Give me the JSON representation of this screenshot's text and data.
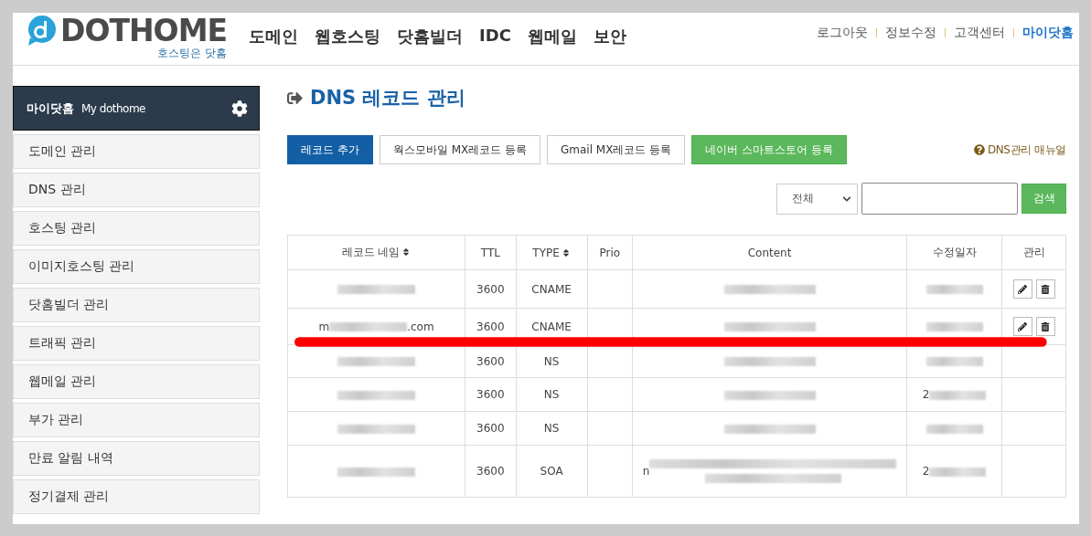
{
  "header": {
    "logo": {
      "name": "DOTHOME",
      "tagline": "호스팅은 닷홈"
    },
    "nav": [
      "도메인",
      "웹호스팅",
      "닷홈빌더",
      "IDC",
      "웹메일",
      "보안"
    ],
    "links": [
      {
        "label": "로그아웃",
        "selected": false
      },
      {
        "label": "정보수정",
        "selected": false
      },
      {
        "label": "고객센터",
        "selected": false
      },
      {
        "label": "마이닷홈",
        "selected": true
      }
    ]
  },
  "sidebar": {
    "title": "마이닷홈",
    "subtitle": "My dothome",
    "items": [
      "도메인 관리",
      "DNS 관리",
      "호스팅 관리",
      "이미지호스팅 관리",
      "닷홈빌더 관리",
      "트래픽 관리",
      "웹메일 관리",
      "부가 관리",
      "만료 알림 내역",
      "정기결제 관리"
    ]
  },
  "page": {
    "title": "DNS 레코드 관리",
    "buttons": [
      {
        "label": "레코드 추가",
        "kind": "primary"
      },
      {
        "label": "웍스모바일 MX레코드 등록",
        "kind": "plain"
      },
      {
        "label": "Gmail MX레코드 등록",
        "kind": "plain"
      },
      {
        "label": "네이버 스마트스토어 등록",
        "kind": "success"
      }
    ],
    "manual_link": "DNS관리 매뉴얼",
    "search": {
      "filter": "전체",
      "button": "검색"
    },
    "table": {
      "columns": [
        {
          "label": "레코드 네임",
          "sortable": true
        },
        {
          "label": "TTL",
          "sortable": false
        },
        {
          "label": "TYPE",
          "sortable": true
        },
        {
          "label": "Prio",
          "sortable": false
        },
        {
          "label": "Content",
          "sortable": false
        },
        {
          "label": "수정일자",
          "sortable": false
        },
        {
          "label": "관리",
          "sortable": false
        }
      ],
      "rows": [
        {
          "name": {
            "kind": "blurred"
          },
          "ttl": "3600",
          "type": "CNAME",
          "content": {
            "kind": "blurred"
          },
          "date": {
            "kind": "blurred"
          },
          "actions": true
        },
        {
          "name": {
            "kind": "blurred",
            "prefix": "m",
            "suffix": ".com"
          },
          "ttl": "3600",
          "type": "CNAME",
          "content": {
            "kind": "blurred"
          },
          "date": {
            "kind": "blurred"
          },
          "actions": true
        },
        {
          "name": {
            "kind": "blurred"
          },
          "ttl": "3600",
          "type": "NS",
          "content": {
            "kind": "blurred"
          },
          "date": {
            "kind": "blurred"
          },
          "actions": false
        },
        {
          "name": {
            "kind": "blurred"
          },
          "ttl": "3600",
          "type": "NS",
          "content": {
            "kind": "blurred"
          },
          "date": {
            "kind": "blurred",
            "prefix": "2"
          },
          "actions": false
        },
        {
          "name": {
            "kind": "blurred"
          },
          "ttl": "3600",
          "type": "NS",
          "content": {
            "kind": "blurred"
          },
          "date": {
            "kind": "blurred"
          },
          "actions": false
        },
        {
          "name": {
            "kind": "blurred"
          },
          "ttl": "3600",
          "type": "SOA",
          "content": {
            "kind": "blurred-two-line",
            "prefix": "n"
          },
          "date": {
            "kind": "blurred",
            "prefix": "2"
          },
          "actions": false
        }
      ]
    }
  },
  "annotation": {
    "kind": "line",
    "color": "#ff0000"
  }
}
